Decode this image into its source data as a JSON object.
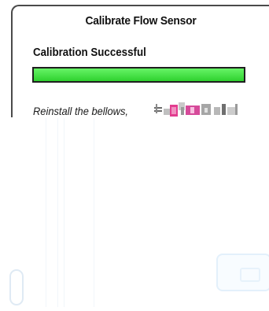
{
  "dialog": {
    "title": "Calibrate Flow Sensor",
    "status": "Calibration Successful",
    "progress_percent": 100,
    "instruction": "Reinstall the bellows,"
  },
  "colors": {
    "progress_fill": "#3fdc3f",
    "border": "#4a4a4a"
  },
  "icons": {
    "left_control": "back-button-icon",
    "right_control": "next-button-icon"
  }
}
